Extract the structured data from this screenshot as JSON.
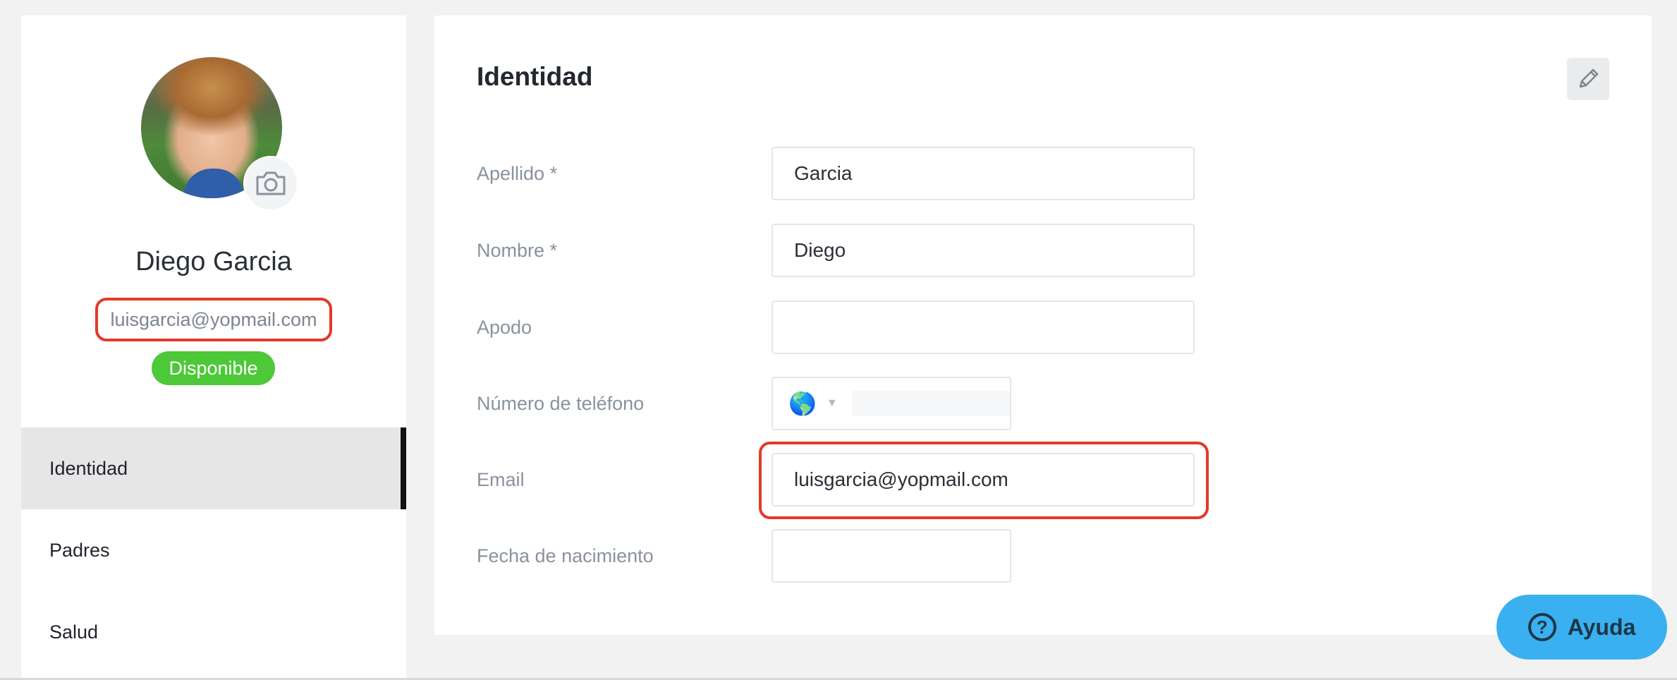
{
  "profile": {
    "name": "Diego Garcia",
    "email": "luisgarcia@yopmail.com",
    "status": "Disponible"
  },
  "nav": {
    "items": [
      {
        "label": "Identidad",
        "active": true
      },
      {
        "label": "Padres",
        "active": false
      },
      {
        "label": "Salud",
        "active": false
      }
    ]
  },
  "panel": {
    "title": "Identidad",
    "fields": {
      "apellido": {
        "label": "Apellido *",
        "value": "Garcia"
      },
      "nombre": {
        "label": "Nombre *",
        "value": "Diego"
      },
      "apodo": {
        "label": "Apodo",
        "value": ""
      },
      "telefono": {
        "label": "Número de teléfono",
        "value": "",
        "country_icon": "🌎"
      },
      "email": {
        "label": "Email",
        "value": "luisgarcia@yopmail.com"
      },
      "fecha_nacimiento": {
        "label": "Fecha de nacimiento",
        "value": ""
      }
    }
  },
  "help": {
    "label": "Ayuda",
    "icon": "?"
  },
  "colors": {
    "highlight": "#e13a2c",
    "status_green": "#4cc838",
    "help_blue": "#3ab0f0",
    "active_nav_bg": "#e6e6e6"
  }
}
